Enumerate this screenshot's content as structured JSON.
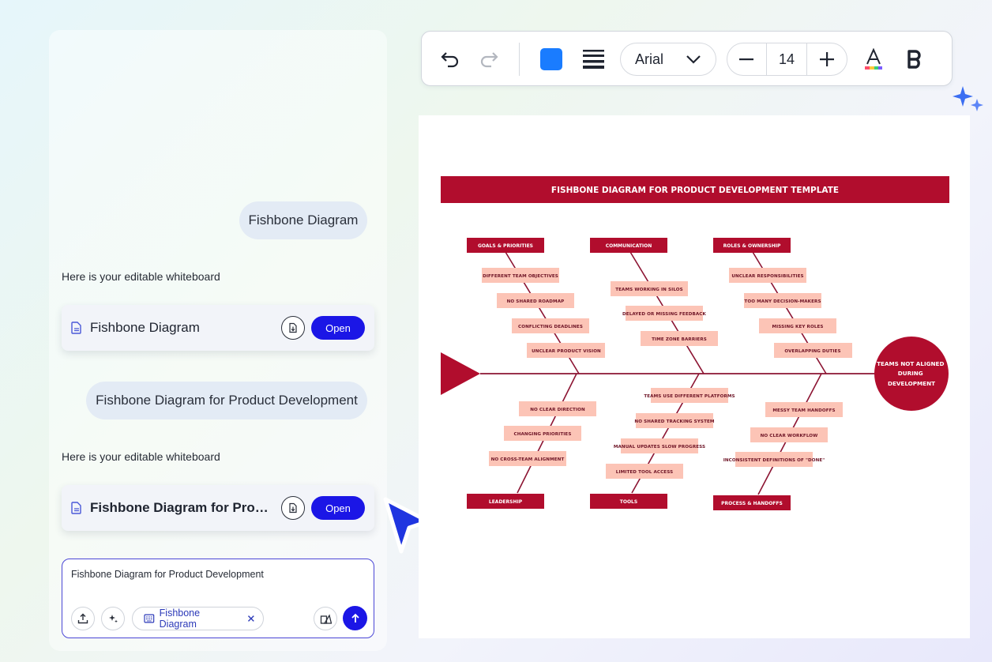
{
  "chat": {
    "messages": [
      {
        "role": "user",
        "text": "Fishbone Diagram"
      },
      {
        "role": "assistant",
        "text": "Here is your editable whiteboard"
      },
      {
        "role": "user",
        "text": "Fishbone Diagram for Product Development"
      },
      {
        "role": "assistant",
        "text": "Here is your editable whiteboard"
      }
    ],
    "cards": [
      {
        "title": "Fishbone Diagram",
        "open_label": "Open"
      },
      {
        "title": "Fishbone Diagram for Product Development",
        "open_label": "Open"
      }
    ]
  },
  "composer": {
    "value": "Fishbone Diagram for Product Development",
    "chip_label": "Fishbone Diagram",
    "icons": [
      "upload-icon",
      "sparkle-icon",
      "whiteboard-icon",
      "close-icon",
      "shapes-icon",
      "send-icon"
    ]
  },
  "toolbar": {
    "font_family": "Arial",
    "font_size": "14",
    "fill_color": "#1a7cff",
    "icons": [
      "undo-icon",
      "redo-icon",
      "stroke-weight-icon",
      "chevron-down-icon",
      "minus-icon",
      "plus-icon",
      "text-color-icon",
      "bold-icon"
    ]
  },
  "diagram": {
    "title": "FISHBONE DIAGRAM FOR PRODUCT DEVELOPMENT TEMPLATE",
    "head": "TEAMS NOT ALIGNED DURING DEVELOPMENT",
    "colors": {
      "primary": "#b10d2d",
      "cause_box": "#fcc4b6"
    },
    "top_categories": [
      {
        "name": "GOALS & PRIORITIES",
        "causes": [
          "DIFFERENT TEAM OBJECTIVES",
          "NO SHARED ROADMAP",
          "CONFLICTING DEADLINES",
          "UNCLEAR PRODUCT VISION"
        ]
      },
      {
        "name": "COMMUNICATION",
        "causes": [
          "TEAMS WORKING IN SILOS",
          "DELAYED OR MISSING FEEDBACK",
          "TIME ZONE BARRIERS"
        ]
      },
      {
        "name": "ROLES & OWNERSHIP",
        "causes": [
          "UNCLEAR RESPONSIBILITIES",
          "TOO MANY DECISION-MAKERS",
          "MISSING KEY ROLES",
          "OVERLAPPING DUTIES"
        ]
      }
    ],
    "bottom_categories": [
      {
        "name": "LEADERSHIP",
        "causes": [
          "NO CLEAR DIRECTION",
          "CHANGING PRIORITIES",
          "NO CROSS-TEAM ALIGNMENT"
        ]
      },
      {
        "name": "TOOLS",
        "causes": [
          "TEAMS USE DIFFERENT PLATFORMS",
          "NO SHARED TRACKING SYSTEM",
          "MANUAL UPDATES SLOW PROGRESS",
          "LIMITED TOOL ACCESS"
        ]
      },
      {
        "name": "PROCESS & HANDOFFS",
        "causes": [
          "MESSY TEAM HANDOFFS",
          "NO CLEAR WORKFLOW",
          "INCONSISTENT DEFINITIONS OF \"DONE\""
        ]
      }
    ]
  }
}
